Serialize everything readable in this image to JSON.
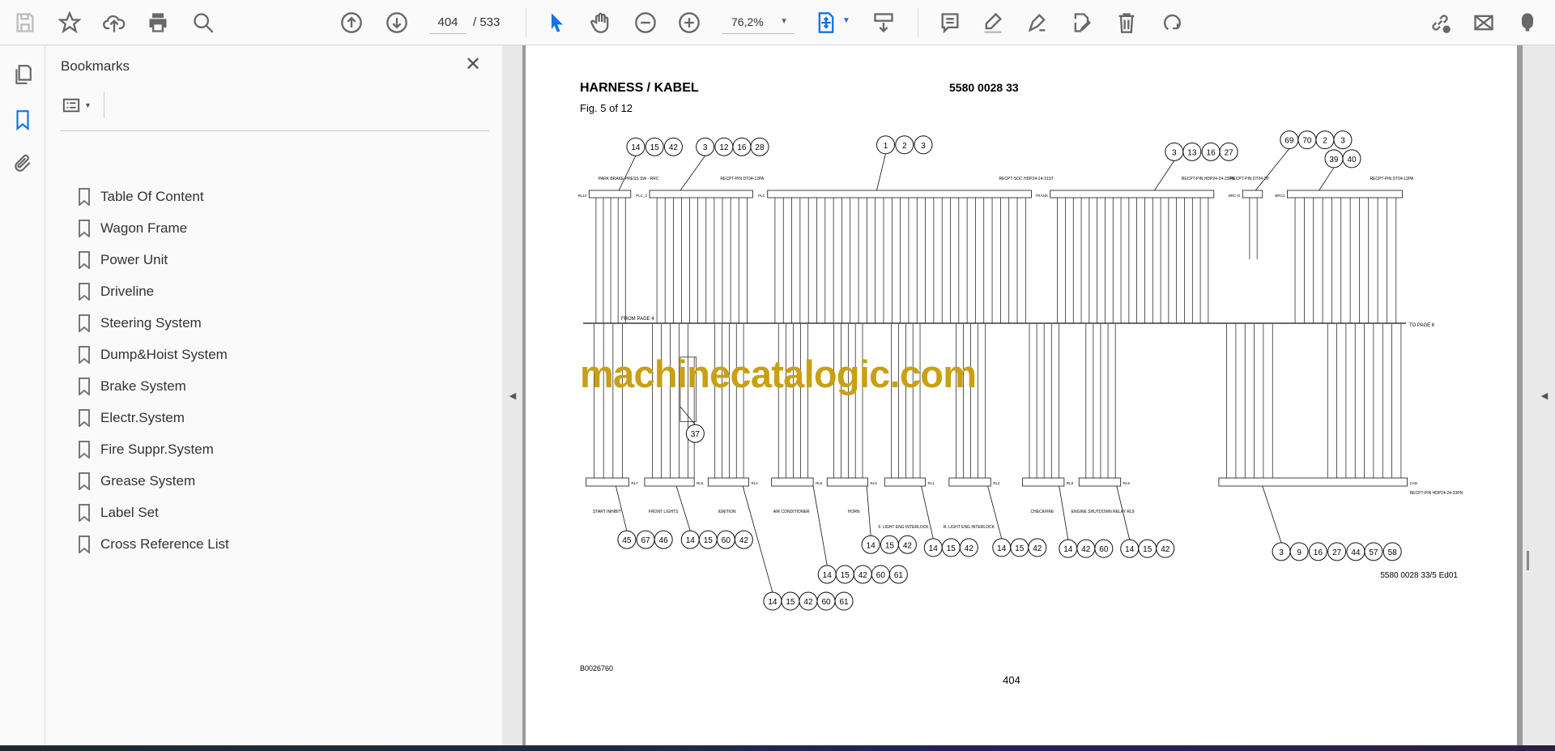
{
  "toolbar": {
    "page_current": "404",
    "page_total": "/ 533",
    "zoom": "76,2%",
    "icons": [
      "save-icon",
      "bookmark-star-icon",
      "upload-cloud-icon",
      "print-icon",
      "search-icon",
      "page-up-icon",
      "page-down-icon",
      "select-cursor-icon",
      "hand-icon",
      "zoom-out-icon",
      "zoom-in-icon",
      "fit-page-icon",
      "scroll-mode-icon",
      "comment-icon",
      "highlight-icon",
      "sign-icon",
      "edit-pdf-icon",
      "delete-icon",
      "rotate-icon",
      "share-link-icon",
      "email-icon",
      "add-user-icon"
    ],
    "accent": "#1473e6"
  },
  "panel": {
    "title": "Bookmarks",
    "items": [
      {
        "label": "Table Of Content"
      },
      {
        "label": "Wagon Frame"
      },
      {
        "label": "Power Unit"
      },
      {
        "label": "Driveline"
      },
      {
        "label": "Steering System"
      },
      {
        "label": "Dump&Hoist System"
      },
      {
        "label": "Brake System"
      },
      {
        "label": "Electr.System"
      },
      {
        "label": "Fire Suppr.System"
      },
      {
        "label": "Grease System"
      },
      {
        "label": "Label Set"
      },
      {
        "label": "Cross Reference List"
      }
    ]
  },
  "document": {
    "title": "HARNESS / KABEL",
    "part_number": "5580 0028 33",
    "figure": "Fig. 5 of 12",
    "from_page": "FROM PAGE 4",
    "to_page": "TO PAGE 6",
    "drawing_ref": "5580 0028 33/5 Ed01",
    "doc_code": "B0026760",
    "page_number": "404",
    "watermark": "machinecatalogic.com",
    "watermark_color": "#c9a012",
    "top_callouts": [
      [
        "14",
        "15",
        "42"
      ],
      [
        "3",
        "12",
        "16",
        "28"
      ],
      [
        "1",
        "2",
        "3"
      ],
      [
        "3",
        "13",
        "16",
        "27"
      ],
      [
        "69",
        "70",
        "2",
        "3"
      ],
      [
        "39",
        "40"
      ]
    ],
    "top_connectors": [
      {
        "name": "RL10",
        "label": "PARK BRAKE PRESS SW - RRC"
      },
      {
        "name": "PLC_2",
        "label": "RECPT-PIN DT04-12PA"
      },
      {
        "name": "PLC",
        "label": "RECPT-SOC HDP24-24-31ST"
      },
      {
        "name": "TRANS",
        "label": "RECPT-PIN HDP24-24-23PN"
      },
      {
        "name": "BRC-D",
        "label": "RECPT-PIN DT04-2P"
      },
      {
        "name": "BRC2",
        "label": "RECPT-PIN DT04-12PA"
      }
    ],
    "bottom_connectors": [
      {
        "name": "RL7",
        "label": "START INHIBIT"
      },
      {
        "name": "RL8",
        "label": "FRONT LIGHTS"
      },
      {
        "name": "RL4",
        "label": "IGNITION"
      },
      {
        "name": "RL5",
        "label": "AIR CONDITIONER"
      },
      {
        "name": "RL6",
        "label": "HORN"
      },
      {
        "name": "RL1",
        "label": "F. LIGHT ENG INTERLOCK"
      },
      {
        "name": "RL2",
        "label": "R. LIGHT ENG INTERLOCK"
      },
      {
        "name": "RL8",
        "label": "CHECKFIRE"
      },
      {
        "name": "RL9",
        "label": "ENGINE SHUTDOWN RELAY RL9"
      },
      {
        "name": "CAB",
        "label": "RECPT-PIN HDP24-24-23PN"
      }
    ],
    "bottom_callouts": [
      [
        "45",
        "67",
        "46"
      ],
      [
        "14",
        "15",
        "60",
        "42"
      ],
      [
        "14",
        "15",
        "42",
        "60",
        "61"
      ],
      [
        "14",
        "15",
        "42",
        "60",
        "61"
      ],
      [
        "14",
        "15",
        "42"
      ],
      [
        "14",
        "15",
        "42"
      ],
      [
        "14",
        "15",
        "42"
      ],
      [
        "14",
        "42",
        "60"
      ],
      [
        "14",
        "15",
        "42"
      ],
      [
        "3",
        "9",
        "16",
        "27",
        "44",
        "57",
        "58"
      ],
      [
        "37"
      ]
    ]
  }
}
